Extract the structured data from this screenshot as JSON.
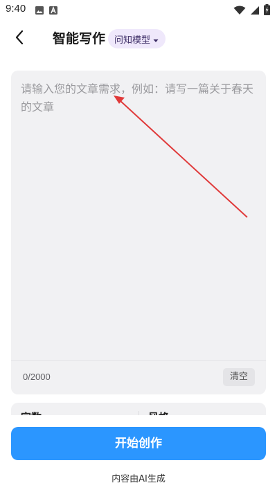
{
  "status_bar": {
    "time": "9:40",
    "left_icons": [
      "image-icon",
      "a-box-icon"
    ],
    "right_icons": [
      "wifi-icon",
      "signal-icon",
      "battery-charging-icon"
    ]
  },
  "header": {
    "back_icon": "chevron-left-icon",
    "title": "智能写作",
    "model_label": "问知模型",
    "model_dropdown_icon": "caret-down-icon"
  },
  "editor": {
    "placeholder": "请输入您的文章需求，例如：请写一篇关于春天的文章",
    "value": "",
    "char_count": "0/2000",
    "clear_label": "清空"
  },
  "options": {
    "word_count_label": "字数",
    "style_label": "风格"
  },
  "actions": {
    "start_label": "开始创作",
    "ai_note": "内容由AI生成"
  },
  "colors": {
    "accent": "#2b96ff",
    "pill_bg": "#efe8fb",
    "card_bg": "#f1f1f3",
    "annotation_arrow": "#e03a3a"
  }
}
